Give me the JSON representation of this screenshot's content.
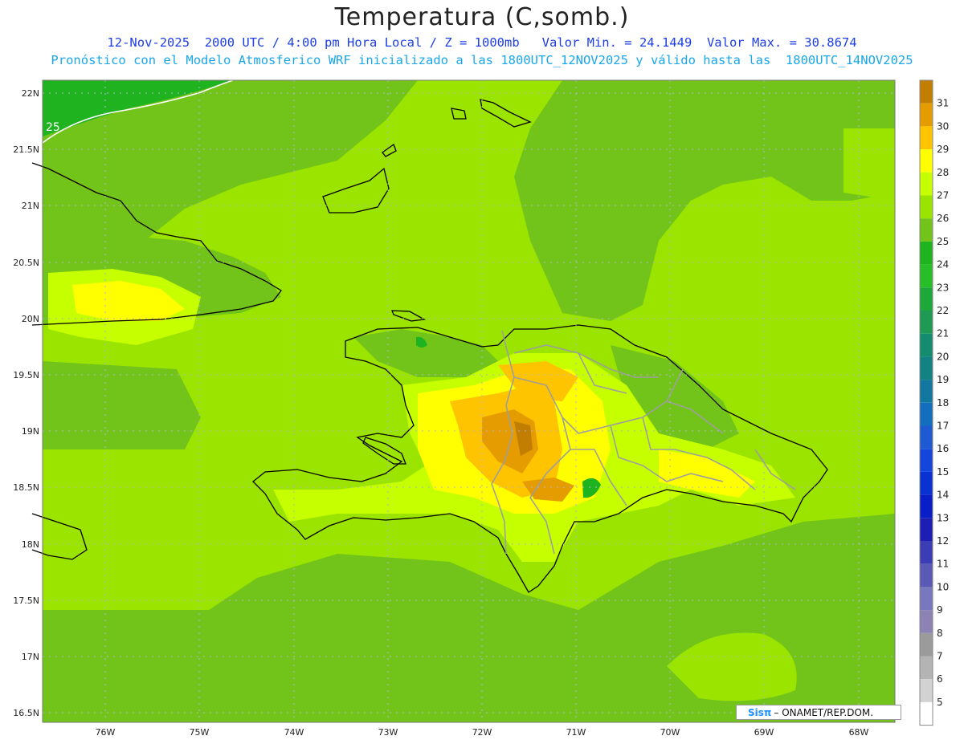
{
  "header": {
    "title": "Temperatura (C,somb.)",
    "line1": "12-Nov-2025  2000 UTC / 4:00 pm Hora Local / Z = 1000mb   Valor Min. = 24.1449  Valor Max. = 30.8674",
    "line2": "Pronóstico con el Modelo Atmosferico WRF inicializado a las 1800UTC_12NOV2025 y válido hasta las  1800UTC_14NOV2025"
  },
  "axes": {
    "lat_labels": [
      "22N",
      "21.5N",
      "21N",
      "20.5N",
      "20N",
      "19.5N",
      "19N",
      "18.5N",
      "18N",
      "17.5N",
      "17N",
      "16.5N"
    ],
    "lon_labels": [
      "76W",
      "75W",
      "74W",
      "73W",
      "72W",
      "71W",
      "70W",
      "69W",
      "68W"
    ]
  },
  "map": {
    "contour_label": "25",
    "units": "C",
    "min_value": 24.1449,
    "max_value": 30.8674,
    "dominant_band": "26-27",
    "hot_region": "Hispaniola interior 29-31",
    "cool_region": "northwest corner 24-25"
  },
  "colorbar": {
    "levels": [
      {
        "label": "31",
        "color": "#c27e00"
      },
      {
        "label": "30",
        "color": "#e49c00"
      },
      {
        "label": "29",
        "color": "#ffc400"
      },
      {
        "label": "28",
        "color": "#ffff00"
      },
      {
        "label": "27",
        "color": "#c6ff00"
      },
      {
        "label": "26",
        "color": "#9ae400"
      },
      {
        "label": "25",
        "color": "#73c41a"
      },
      {
        "label": "24",
        "color": "#1fb41f"
      },
      {
        "label": "23",
        "color": "#28be28"
      },
      {
        "label": "22",
        "color": "#1ea83a"
      },
      {
        "label": "21",
        "color": "#1e9a55"
      },
      {
        "label": "20",
        "color": "#148c6e"
      },
      {
        "label": "19",
        "color": "#128282"
      },
      {
        "label": "18",
        "color": "#1278a0"
      },
      {
        "label": "17",
        "color": "#146ebe"
      },
      {
        "label": "16",
        "color": "#1e5ad2"
      },
      {
        "label": "15",
        "color": "#1446dc"
      },
      {
        "label": "14",
        "color": "#0a32d2"
      },
      {
        "label": "13",
        "color": "#0a1ec8"
      },
      {
        "label": "12",
        "color": "#1e1eb4"
      },
      {
        "label": "11",
        "color": "#3c3cb4"
      },
      {
        "label": "10",
        "color": "#5a5ab4"
      },
      {
        "label": "9",
        "color": "#7878be"
      },
      {
        "label": "8",
        "color": "#8c82b4"
      },
      {
        "label": "7",
        "color": "#9b9b9b"
      },
      {
        "label": "6",
        "color": "#b4b4b4"
      },
      {
        "label": "5",
        "color": "#d2d2d2"
      },
      {
        "label": "",
        "color": "#ffffff"
      }
    ]
  },
  "credit": {
    "brand": "Sisπ",
    "text": "– ONAMET/REP.DOM."
  }
}
